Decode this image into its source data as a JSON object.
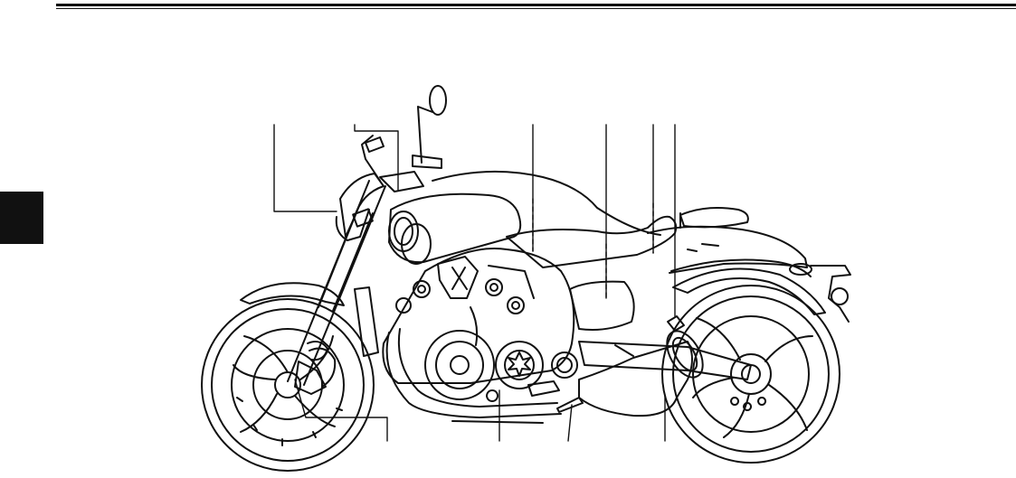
{
  "page": {
    "header_rule": "double-rule",
    "chapter_tab_color": "#111111"
  },
  "figure": {
    "subject": "motorcycle-left-side-view",
    "stroke_color": "#111111",
    "callout_count_top": 7,
    "callout_count_bottom": 4
  }
}
